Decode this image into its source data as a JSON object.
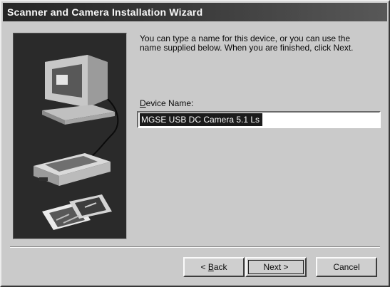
{
  "window": {
    "title": "Scanner and Camera Installation Wizard"
  },
  "instructions": "You can type a name for this device, or you can use the name supplied below.  When you are finished, click Next.",
  "device_name": {
    "label_mnemonic": "D",
    "label_rest": "evice Name:",
    "value": "MGSE USB DC Camera 5.1 Ls"
  },
  "buttons": {
    "back_prefix": "< ",
    "back_mnemonic": "B",
    "back_rest": "ack",
    "next": "Next >",
    "cancel": "Cancel"
  },
  "icons": {
    "art": [
      "computer-icon",
      "scanner-icon",
      "photos-icon"
    ]
  }
}
